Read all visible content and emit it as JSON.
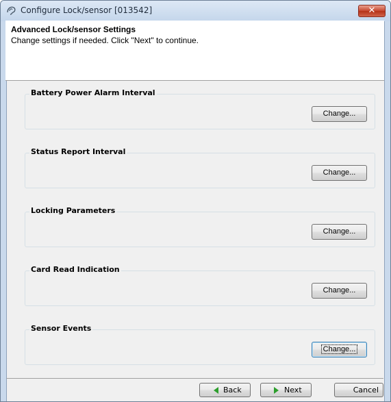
{
  "window": {
    "title": "Configure Lock/sensor [013542]",
    "close_glyph": "✕",
    "app_icon": "ear-wave-icon"
  },
  "header": {
    "title": "Advanced Lock/sensor Settings",
    "subtitle": "Change settings if needed. Click \"Next\" to continue."
  },
  "groups": [
    {
      "label": "Battery Power Alarm Interval",
      "button": "Change..."
    },
    {
      "label": "Status Report Interval",
      "button": "Change..."
    },
    {
      "label": "Locking Parameters",
      "button": "Change..."
    },
    {
      "label": "Card Read Indication",
      "button": "Change..."
    },
    {
      "label": "Sensor Events",
      "button": "Change..."
    }
  ],
  "footer": {
    "back_label": "Back",
    "next_label": "Next",
    "cancel_label": "Cancel"
  },
  "colors": {
    "arrow_green": "#2c9e2c",
    "close_red": "#c74a33",
    "focus_blue": "#3c7fb1"
  }
}
